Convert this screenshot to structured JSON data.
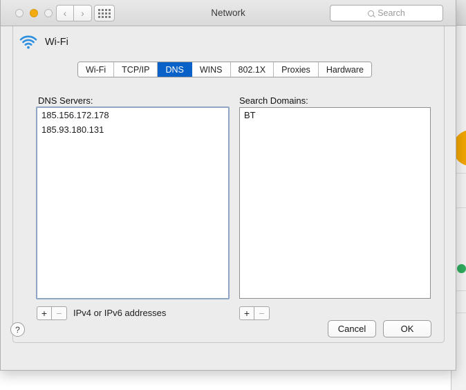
{
  "window": {
    "title": "Network",
    "traffic_lights": [
      "close",
      "minimize",
      "zoom"
    ],
    "nav": {
      "back": "‹",
      "forward": "›"
    },
    "show_all_icon": "grid-icon",
    "search": {
      "placeholder": "Search",
      "value": "",
      "icon": "search-icon"
    }
  },
  "service": {
    "name": "Wi-Fi",
    "icon": "wifi-icon"
  },
  "tabs": [
    {
      "label": "Wi-Fi",
      "selected": false
    },
    {
      "label": "TCP/IP",
      "selected": false
    },
    {
      "label": "DNS",
      "selected": true
    },
    {
      "label": "WINS",
      "selected": false
    },
    {
      "label": "802.1X",
      "selected": false
    },
    {
      "label": "Proxies",
      "selected": false
    },
    {
      "label": "Hardware",
      "selected": false
    }
  ],
  "dns_servers": {
    "label": "DNS Servers:",
    "entries": [
      "185.156.172.178",
      "185.93.180.131"
    ],
    "hint": "IPv4 or IPv6 addresses",
    "add_label": "+",
    "remove_label": "−"
  },
  "search_domains": {
    "label": "Search Domains:",
    "entries": [
      "BT"
    ],
    "add_label": "+",
    "remove_label": "−"
  },
  "footer": {
    "help_label": "?",
    "cancel_label": "Cancel",
    "ok_label": "OK"
  },
  "colors": {
    "accent_blue": "#0a62c8",
    "minimize_yellow": "#f4ab10",
    "focus_ring": "#8fa5c4",
    "window_chrome": "#ececec"
  }
}
